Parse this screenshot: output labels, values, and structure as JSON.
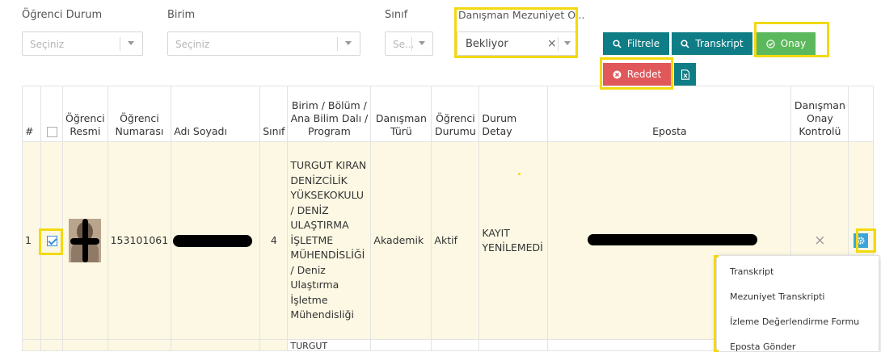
{
  "filters": {
    "ogrenci_durum": {
      "label": "Öğrenci Durum",
      "placeholder": "Seçiniz"
    },
    "birim": {
      "label": "Birim",
      "placeholder": "Seçiniz"
    },
    "sinif": {
      "label": "Sınıf",
      "placeholder": "Se..."
    },
    "danisman_mezuniyet": {
      "label": "Danışman Mezuniyet O...",
      "value": "Bekliyor",
      "clear_glyph": "×"
    }
  },
  "buttons": {
    "filtrele": "Filtrele",
    "transkript": "Transkript",
    "onay": "Onay",
    "reddet": "Reddet"
  },
  "table": {
    "headers": {
      "index": "#",
      "resim": "Öğrenci Resmi",
      "numara": "Öğrenci Numarası",
      "adsoyad": "Adı Soyadı",
      "sinif": "Sınıf",
      "birim": "Birim / Bölüm / Ana Bilim Dalı / Program",
      "danisman_turu": "Danışman Türü",
      "ogrenci_durumu": "Öğrenci Durumu",
      "durum_detay": "Durum Detay",
      "eposta": "Eposta",
      "danisman_onay": "Danışman Onay Kontrolü"
    },
    "row": {
      "index": "1",
      "numara": "153101061",
      "sinif": "4",
      "birim": "TURGUT KIRAN DENİZCİLİK YÜKSEKOKULU / DENİZ ULAŞTIRMA İŞLETME MÜHENDİSLİĞİ / Deniz Ulaştırma İşletme Mühendisliği",
      "danisman_turu": "Akademik",
      "ogrenci_durumu": "Aktif",
      "durum_detay": "KAYIT YENİLEMEDİ",
      "onay_kontrol": "×"
    },
    "next_row_partial": "TURGUT"
  },
  "context_menu": {
    "items": [
      "Transkript",
      "Mezuniyet Transkripti",
      "İzleme Değerlendirme Formu",
      "Eposta Gönder"
    ]
  },
  "colors": {
    "teal": "#0f7d86",
    "green": "#5cb85c",
    "red": "#e0585a",
    "highlight": "#f3d90f",
    "row_bg": "#fcf8e3"
  }
}
